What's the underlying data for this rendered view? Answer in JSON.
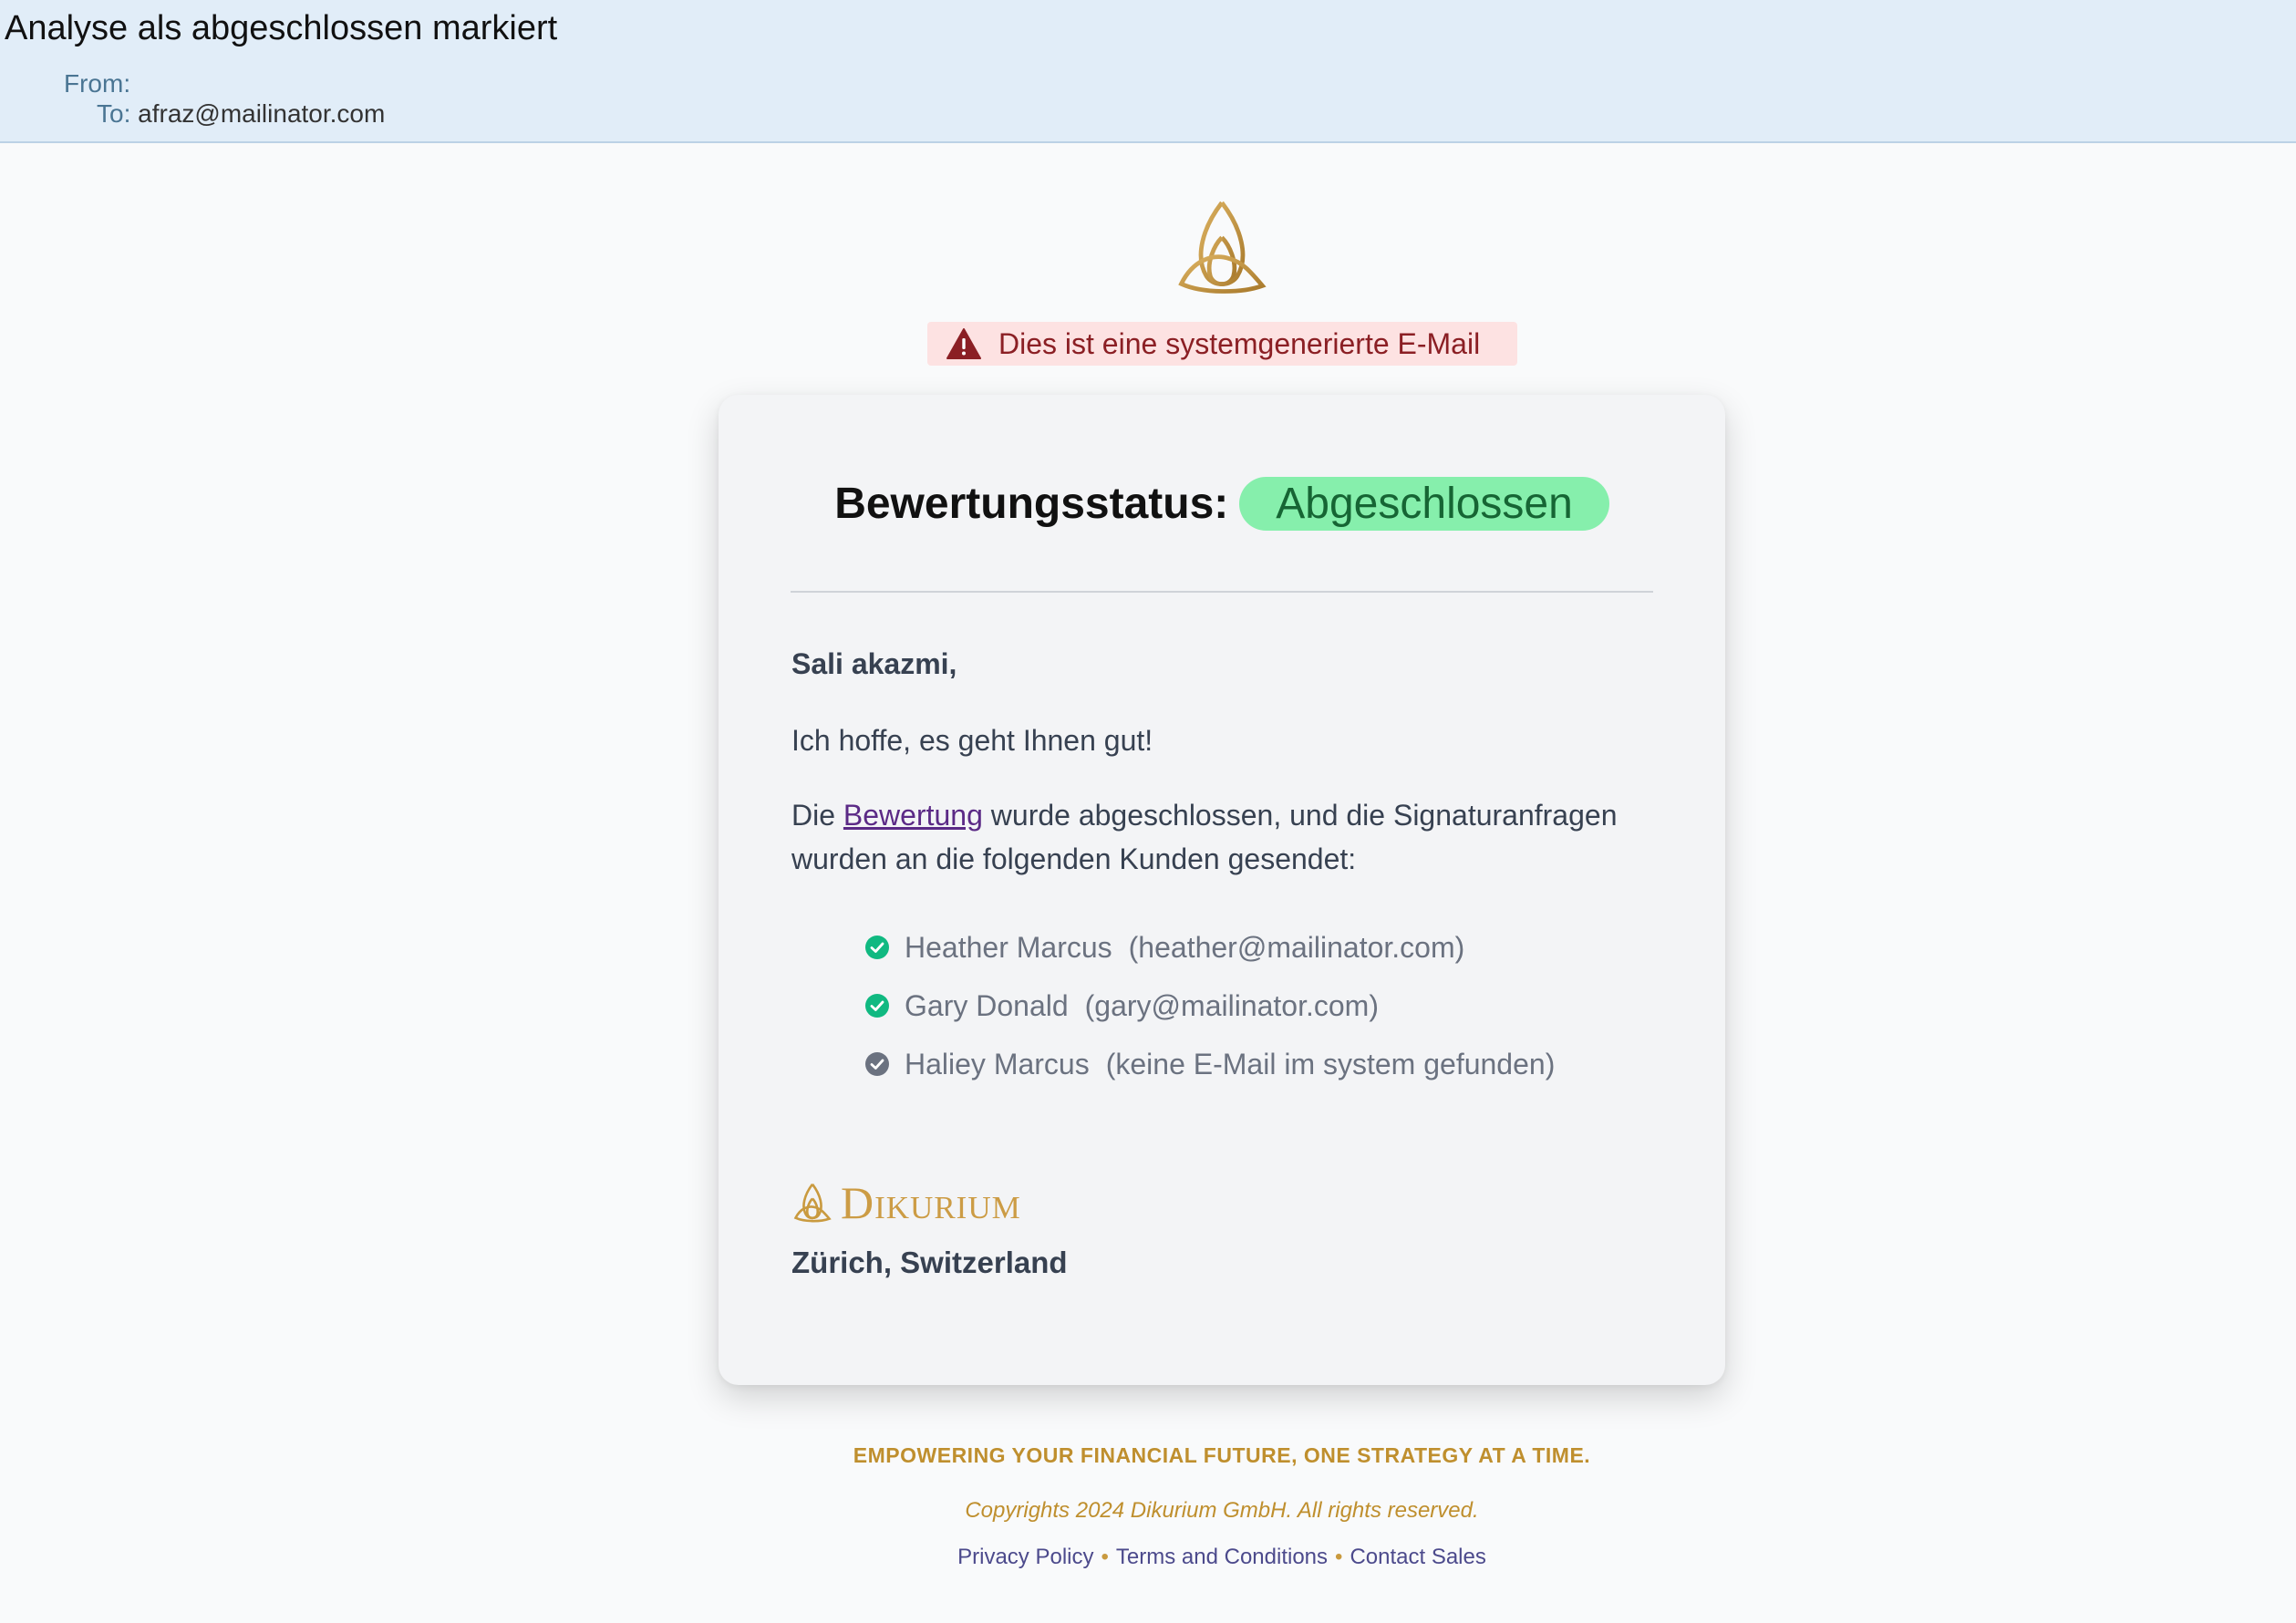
{
  "email": {
    "subject": "Analyse als abgeschlossen markiert",
    "from_label": "From:",
    "from_value": "",
    "to_label": "To:",
    "to_value": "afraz@mailinator.com"
  },
  "warning": {
    "text": "Dies ist eine systemgenerierte E-Mail",
    "icon": "warning-triangle-icon"
  },
  "logo": {
    "icon": "triquetra-logo-icon",
    "color": "#c99a3f"
  },
  "card": {
    "status_title": "Bewertungsstatus:",
    "status_value": "Abgeschlossen",
    "greeting": "Sali akazmi,",
    "line1": "Ich hoffe, es geht Ihnen gut!",
    "line2_prefix": "Die",
    "line2_link": "Bewertung",
    "line2_suffix": "wurde abgeschlossen, und die Signaturanfragen wurden an die folgenden Kunden gesendet:",
    "clients": [
      {
        "name": "Heather Marcus",
        "email": "(heather@mailinator.com)",
        "status": "sent",
        "color": "#10b981"
      },
      {
        "name": "Gary Donald",
        "email": "(gary@mailinator.com)",
        "status": "sent",
        "color": "#10b981"
      },
      {
        "name": "Haliey Marcus",
        "email": "(keine E-Mail im system gefunden)",
        "status": "no-email",
        "color": "#6b7280"
      }
    ],
    "brand_name": "Dikurium",
    "location": "Zürich, Switzerland"
  },
  "footer": {
    "tagline": "EMPOWERING YOUR FINANCIAL FUTURE, ONE STRATEGY AT A TIME.",
    "copyright": "Copyrights 2024 Dikurium GmbH. All rights reserved.",
    "links": [
      "Privacy Policy",
      "Terms and Conditions",
      "Contact Sales"
    ],
    "separator": "•"
  },
  "colors": {
    "accent_gold": "#c99a3f",
    "status_badge_bg": "#86efac",
    "status_badge_text": "#166534",
    "warning_bg": "#fde2e2",
    "warning_text": "#8b1f24"
  }
}
